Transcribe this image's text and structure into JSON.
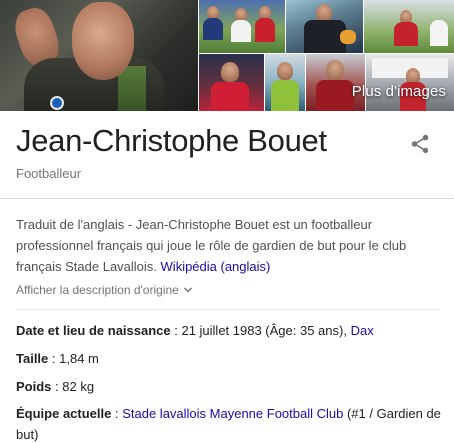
{
  "images": {
    "more_images_label": "Plus d'images"
  },
  "entity": {
    "name": "Jean-Christophe Bouet",
    "type": "Footballeur"
  },
  "description": {
    "text": "Traduit de l'anglais - Jean-Christophe Bouet est un footballeur professionnel français qui joue le rôle de gardien de but pour le club français Stade Lavallois. ",
    "source_link": "Wikipédia (anglais)",
    "show_original": "Afficher la description d'origine"
  },
  "facts": {
    "birth": {
      "label": "Date et lieu de naissance",
      "value": " : 21 juillet 1983 (Âge: 35 ans), ",
      "link": "Dax"
    },
    "height": {
      "label": "Taille",
      "value": " : 1,84 m"
    },
    "weight": {
      "label": "Poids",
      "value": " : 82 kg"
    },
    "team": {
      "label": "Équipe actuelle",
      "separator": " : ",
      "link": "Stade lavallois Mayenne Football Club",
      "value": " (#1 / Gardien de but)"
    }
  },
  "colors": {
    "link": "#1a0dab",
    "secondary_text": "#70757a",
    "divider": "#dadce0"
  }
}
